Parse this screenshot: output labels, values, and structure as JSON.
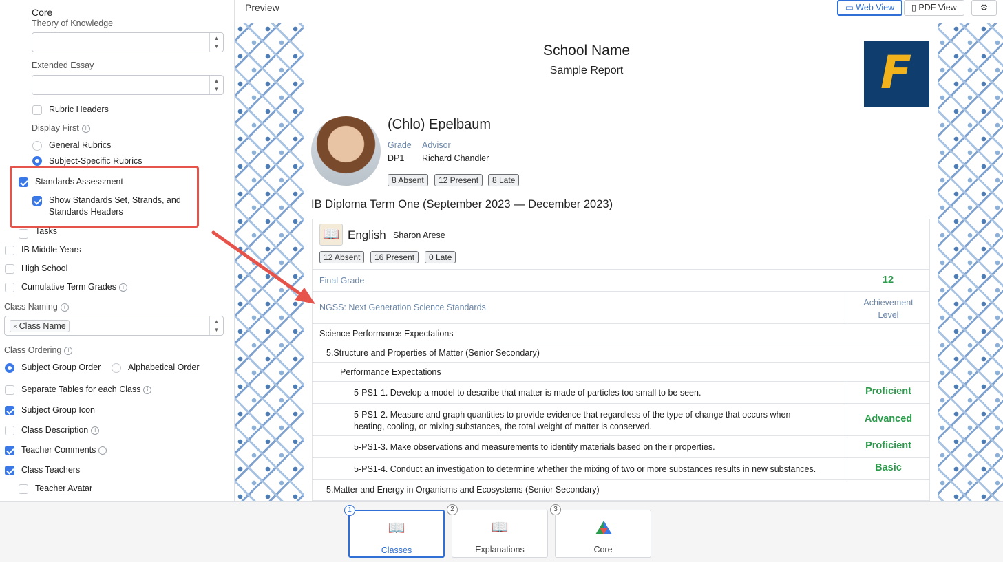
{
  "sidebar": {
    "core_title": "Core",
    "tok_label": "Theory of Knowledge",
    "ee_label": "Extended Essay",
    "rubric_headers": "Rubric Headers",
    "display_first": "Display First",
    "general_rubrics": "General Rubrics",
    "subject_rubrics": "Subject-Specific Rubrics",
    "standards_assessment": "Standards Assessment",
    "show_standards": "Show Standards Set, Strands, and",
    "show_standards_2": "Standards Headers",
    "tasks": "Tasks",
    "ib_middle": "IB Middle Years",
    "high_school": "High School",
    "cumulative": "Cumulative Term Grades",
    "class_naming": "Class Naming",
    "class_name_tag": "Class Name",
    "class_ordering": "Class Ordering",
    "subject_group_order": "Subject Group Order",
    "alphabetical_order": "Alphabetical Order",
    "separate_tables": "Separate Tables for each Class",
    "subject_group_icon": "Subject Group Icon",
    "class_description": "Class Description",
    "teacher_comments": "Teacher Comments",
    "class_teachers": "Class Teachers",
    "teacher_avatar": "Teacher Avatar"
  },
  "preview": {
    "title": "Preview",
    "web_view": "Web View",
    "pdf_view": "PDF View"
  },
  "report": {
    "school_name": "School Name",
    "subtitle": "Sample Report",
    "logo_letter": "F",
    "student_name": "(Chlo) Epelbaum",
    "grade_label": "Grade",
    "grade": "DP1",
    "advisor_label": "Advisor",
    "advisor": "Richard Chandler",
    "attendance": [
      "8 Absent",
      "12 Present",
      "8 Late"
    ],
    "term": "IB Diploma Term One (September 2023 — December 2023)",
    "class_name": "English",
    "teacher": "Sharon Arese",
    "class_attendance": [
      "12 Absent",
      "16 Present",
      "0 Late"
    ],
    "final_grade_label": "Final Grade",
    "final_grade": "12",
    "standards_set": "NGSS: Next Generation Science Standards",
    "achievement_level": "Achievement",
    "achievement_level_2": "Level",
    "strand": "Science Performance Expectations",
    "sub_strand": "5.Structure and Properties of Matter (Senior Secondary)",
    "header": "Performance Expectations",
    "standards": [
      {
        "text": "5-PS1-1. Develop a model to describe that matter is made of particles too small to be seen.",
        "level": "Proficient"
      },
      {
        "text": "5-PS1-2. Measure and graph quantities to provide evidence that regardless of the type of change that occurs when",
        "text2": "heating, cooling, or mixing substances, the total weight of matter is conserved.",
        "level": "Advanced"
      },
      {
        "text": "5-PS1-3. Make observations and measurements to identify materials based on their properties.",
        "level": "Proficient"
      },
      {
        "text": "5-PS1-4. Conduct an investigation to determine whether the mixing of two or more substances results in new substances.",
        "level": "Basic"
      }
    ],
    "sub_strand_2": "5.Matter and Energy in Organisms and Ecosystems (Senior Secondary)"
  },
  "steps": [
    {
      "num": "1",
      "label": "Classes"
    },
    {
      "num": "2",
      "label": "Explanations"
    },
    {
      "num": "3",
      "label": "Core"
    }
  ],
  "colors": {
    "accent": "#2f6fd6",
    "highlight": "#e5534b",
    "level_green": "#2b9a4b",
    "logo_bg": "#0f3d6e",
    "logo_fg": "#f2b21b"
  }
}
